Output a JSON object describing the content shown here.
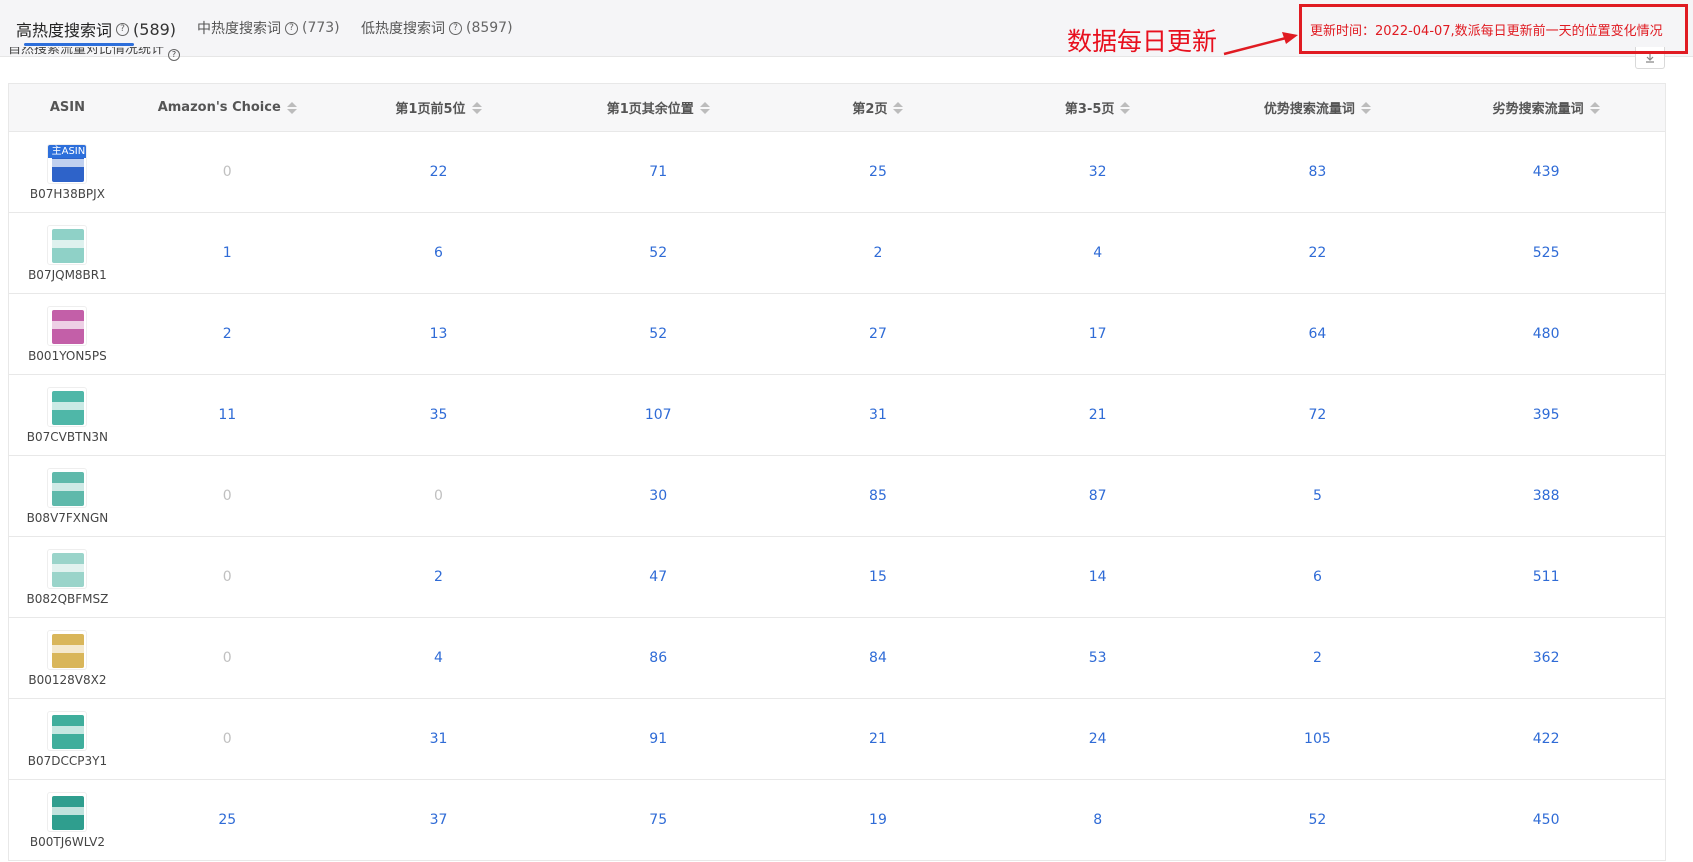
{
  "tabs": [
    {
      "label": "高热度搜索词",
      "count": "(589)",
      "help": "?"
    },
    {
      "label": "中热度搜索词",
      "count": "(773)",
      "help": "?"
    },
    {
      "label": "低热度搜索词",
      "count": "(8597)",
      "help": "?"
    }
  ],
  "subtitle": {
    "text": "自然搜索流量对比情况统计",
    "help": "?"
  },
  "download_icon": "download-icon",
  "annotation": {
    "label": "数据每日更新",
    "update_note": "更新时间：2022-04-07,数派每日更新前一天的位置变化情况",
    "color": "#e01b22"
  },
  "table": {
    "headers": [
      "ASIN",
      "Amazon's Choice",
      "第1页前5位",
      "第1页其余位置",
      "第2页",
      "第3-5页",
      "优势搜索流量词",
      "劣势搜索流量词"
    ],
    "main_tag": "主ASIN",
    "rows": [
      {
        "asin": "B07H38BPJX",
        "values": [
          "0",
          "22",
          "71",
          "25",
          "32",
          "83",
          "439"
        ],
        "thumb_color": "#2e63c9"
      },
      {
        "asin": "B07JQM8BR1",
        "values": [
          "1",
          "6",
          "52",
          "2",
          "4",
          "22",
          "525"
        ],
        "thumb_color": "#8fd1c7"
      },
      {
        "asin": "B001YON5PS",
        "values": [
          "2",
          "13",
          "52",
          "27",
          "17",
          "64",
          "480"
        ],
        "thumb_color": "#c35fa8"
      },
      {
        "asin": "B07CVBTN3N",
        "values": [
          "11",
          "35",
          "107",
          "31",
          "21",
          "72",
          "395"
        ],
        "thumb_color": "#4fb7a8"
      },
      {
        "asin": "B08V7FXNGN",
        "values": [
          "0",
          "0",
          "30",
          "85",
          "87",
          "5",
          "388"
        ],
        "thumb_color": "#5fb9ab"
      },
      {
        "asin": "B082QBFMSZ",
        "values": [
          "0",
          "2",
          "47",
          "15",
          "14",
          "6",
          "511"
        ],
        "thumb_color": "#9ad4ca"
      },
      {
        "asin": "B00128V8X2",
        "values": [
          "0",
          "4",
          "86",
          "84",
          "53",
          "2",
          "362"
        ],
        "thumb_color": "#d9b65a"
      },
      {
        "asin": "B07DCCP3Y1",
        "values": [
          "0",
          "31",
          "91",
          "21",
          "24",
          "105",
          "422"
        ],
        "thumb_color": "#3fae9c"
      },
      {
        "asin": "B00TJ6WLV2",
        "values": [
          "25",
          "37",
          "75",
          "19",
          "8",
          "52",
          "450"
        ],
        "thumb_color": "#2f9e8e"
      }
    ]
  }
}
